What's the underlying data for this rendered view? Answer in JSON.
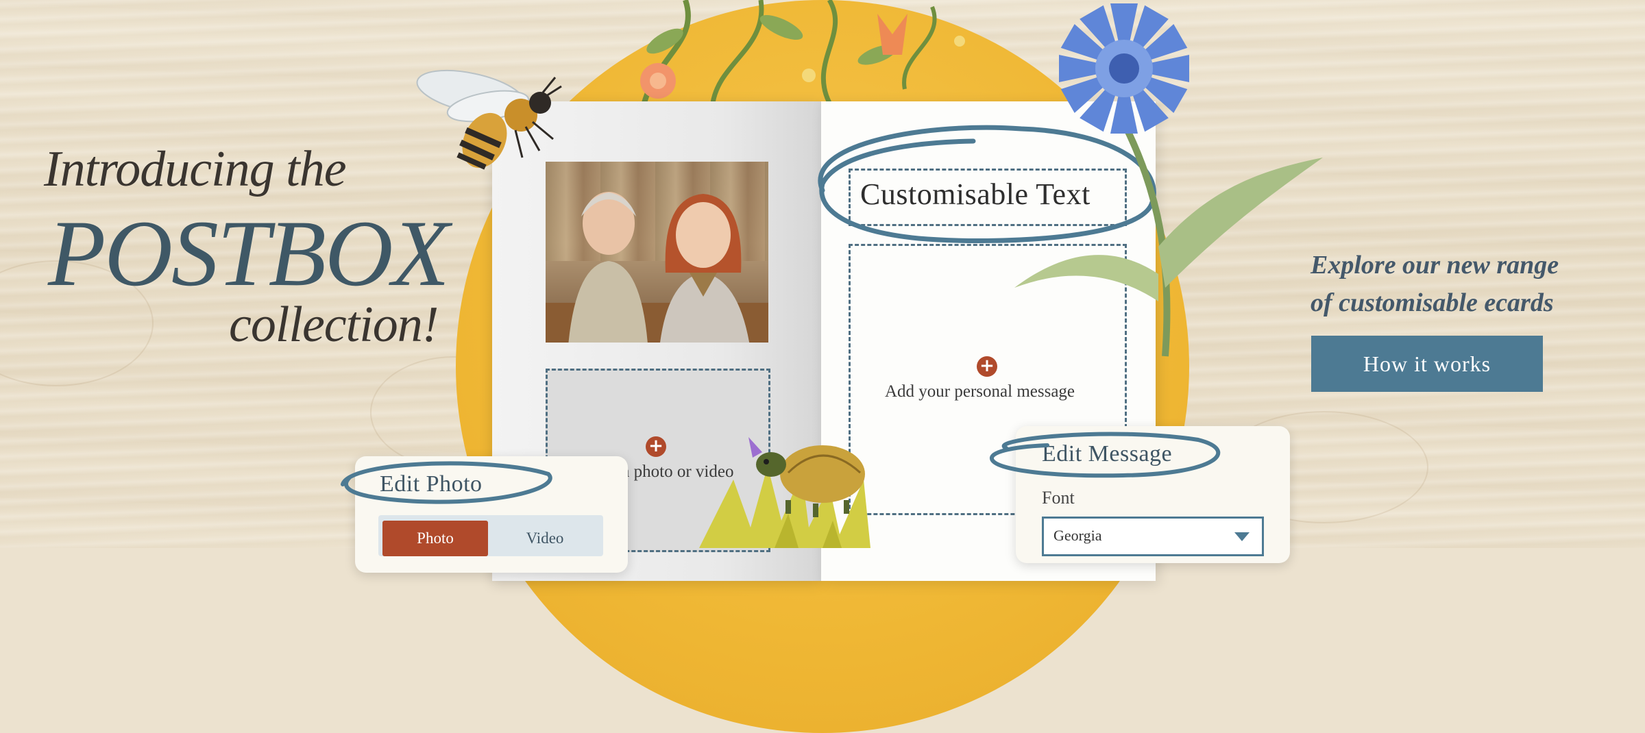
{
  "banner": {
    "intro": "Introducing the",
    "brand": "POSTBOX",
    "collection": "collection!",
    "explore": "Explore our new range of customisable ecards",
    "cta_label": "How it works"
  },
  "card": {
    "title_text": "Customisable Text",
    "message_hint": "Add your personal message",
    "upload_hint": "Add a photo or video"
  },
  "edit_photo": {
    "title": "Edit Photo",
    "tab_photo": "Photo",
    "tab_video": "Video"
  },
  "edit_message": {
    "title": "Edit Message",
    "font_label": "Font",
    "font_value": "Georgia"
  },
  "colors": {
    "accent_blue": "#4d7a93",
    "accent_red": "#b04a2b",
    "sun_yellow": "#efb734"
  },
  "icons": [
    "plus-circle-icon",
    "bee-illustration",
    "cornflower-illustration",
    "tortoise-illustration",
    "chevron-down-icon"
  ]
}
